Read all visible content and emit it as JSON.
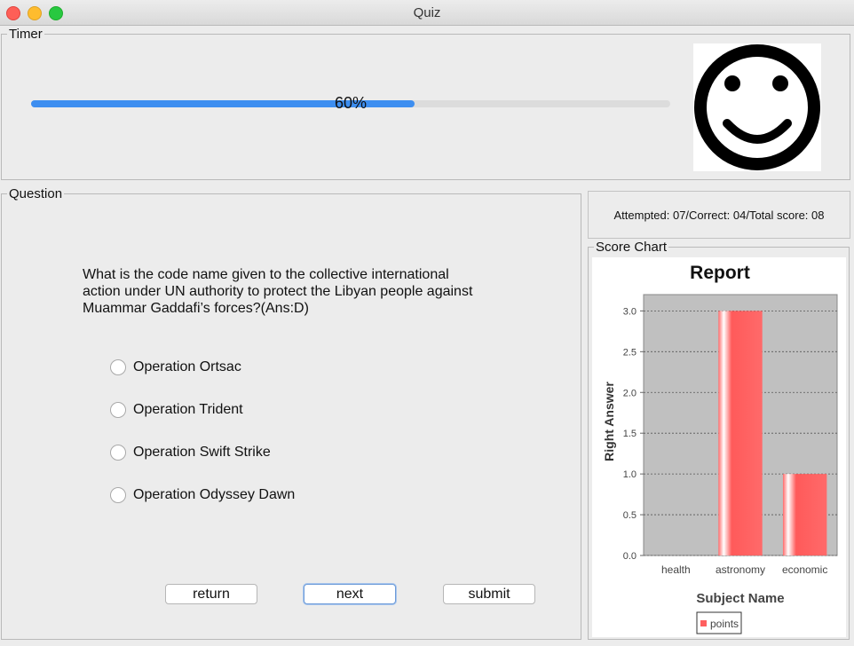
{
  "window": {
    "title": "Quiz"
  },
  "timer": {
    "legend": "Timer",
    "progress_text": "60%",
    "progress_fraction": 0.6
  },
  "question": {
    "legend": "Question",
    "lines": [
      "What is the code name given to the collective international",
      "action under UN authority to protect the Libyan people against",
      "Muammar Gaddafi’s forces?(Ans:D)"
    ],
    "options": [
      "Operation Ortsac",
      "Operation Trident",
      "Operation Swift Strike",
      "Operation Odyssey Dawn"
    ]
  },
  "buttons": {
    "return_label": "return",
    "next_label": "next",
    "submit_label": "submit"
  },
  "stats": {
    "text": "Attempted: 07/Correct: 04/Total score: 08"
  },
  "score_chart": {
    "legend": "Score Chart"
  },
  "colors": {
    "progress": "#3d8ef0",
    "bar": "#ff5f5f",
    "plot_bg": "#c0c0c0"
  },
  "chart_data": {
    "type": "bar",
    "title": "Report",
    "xlabel": "Subject Name",
    "ylabel": "Right Answer",
    "categories": [
      "health",
      "astronomy",
      "economic"
    ],
    "series": [
      {
        "name": "points",
        "values": [
          0,
          3.0,
          1.0
        ]
      }
    ],
    "ylim": [
      0,
      3.2
    ],
    "yticks": [
      "0.0",
      "0.5",
      "1.0",
      "1.5",
      "2.0",
      "2.5",
      "3.0"
    ],
    "grid": true,
    "legend_position": "bottom"
  }
}
